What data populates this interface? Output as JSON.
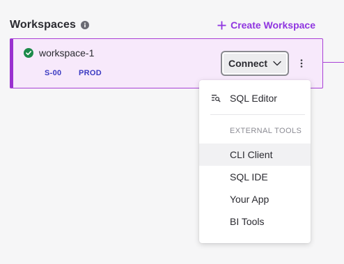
{
  "header": {
    "title": "Workspaces",
    "create_label": "Create Workspace"
  },
  "workspace": {
    "name": "workspace-1",
    "status": "running",
    "size": "S-00",
    "environment": "PROD",
    "connect_label": "Connect"
  },
  "menu": {
    "items_top": [
      {
        "label": "SQL Editor",
        "icon": "sql-editor-icon"
      }
    ],
    "section_label": "EXTERNAL TOOLS",
    "external_tools": [
      {
        "label": "CLI Client"
      },
      {
        "label": "SQL IDE"
      },
      {
        "label": "Your App"
      },
      {
        "label": "BI Tools"
      }
    ]
  },
  "colors": {
    "accent": "#8f35e0",
    "card_bg": "#f7e9fb",
    "status_ok": "#1c8a4a",
    "tag": "#3b3bc2"
  }
}
